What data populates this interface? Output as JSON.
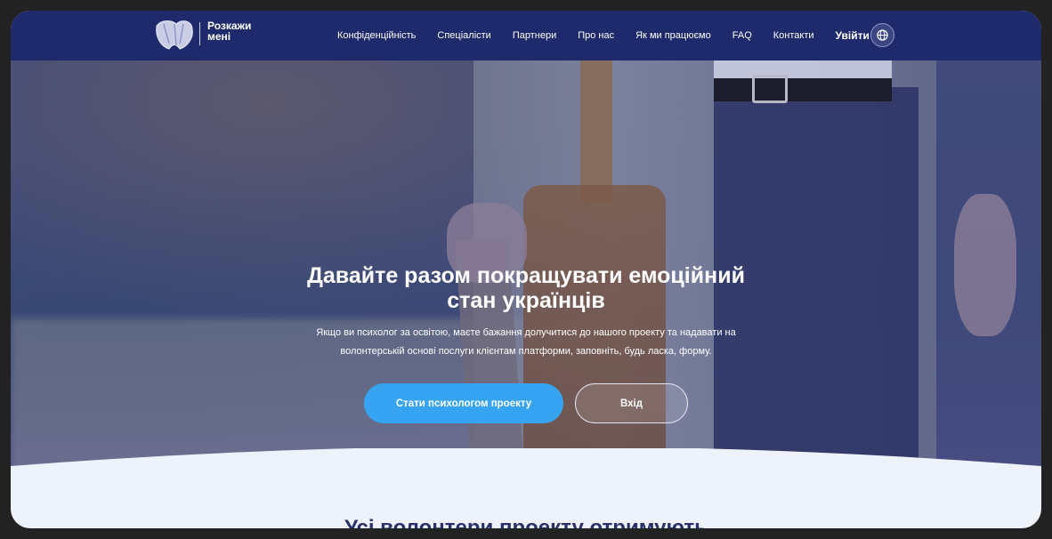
{
  "header": {
    "logo_line1": "Розкажи",
    "logo_line2": "мені",
    "nav": [
      "Конфіденційність",
      "Спеціалісти",
      "Партнери",
      "Про нас",
      "Як ми працюємо",
      "FAQ",
      "Контакти"
    ],
    "login_label": "Увійти",
    "language_icon": "globe-icon"
  },
  "hero": {
    "title_line1": "Давайте разом покращувати емоційний",
    "title_line2": "стан українців",
    "subtitle_line1": "Якщо ви психолог за освітою, маєте бажання долучитися до нашого проекту та надавати на",
    "subtitle_line2": "волонтерській основі послуги клієнтам платформи, заповніть, будь ласка, форму.",
    "primary_button": "Стати психологом проекту",
    "secondary_button": "Вхід"
  },
  "next_section": {
    "heading": "Усі волонтери проекту отримують"
  },
  "colors": {
    "header_bg": "#1e2a6b",
    "primary": "#37a4f1",
    "section_bg": "#eef2fb"
  }
}
